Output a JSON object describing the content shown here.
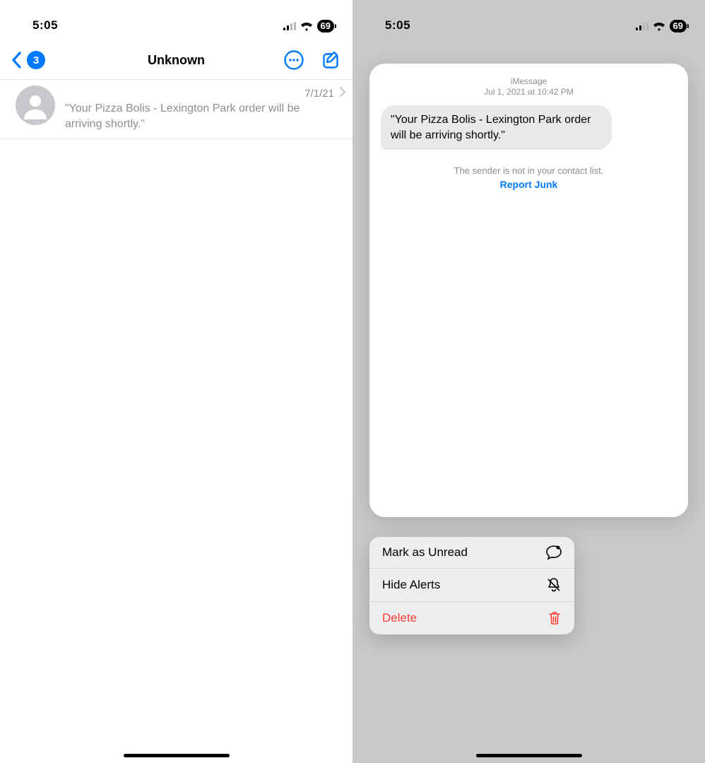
{
  "status": {
    "time": "5:05",
    "battery": "69"
  },
  "nav": {
    "badge": "3",
    "title": "Unknown"
  },
  "row": {
    "date": "7/1/21",
    "preview": "\"Your Pizza Bolis - Lexington Park order will be arriving shortly.\""
  },
  "card": {
    "service": "iMessage",
    "timestamp": "Jul 1, 2021 at 10:42 PM",
    "message": "\"Your Pizza Bolis - Lexington Park order will be arriving shortly.\"",
    "notice": "The sender is not in your contact list.",
    "report": "Report Junk"
  },
  "menu": {
    "mark_unread": "Mark as Unread",
    "hide_alerts": "Hide Alerts",
    "delete": "Delete"
  }
}
